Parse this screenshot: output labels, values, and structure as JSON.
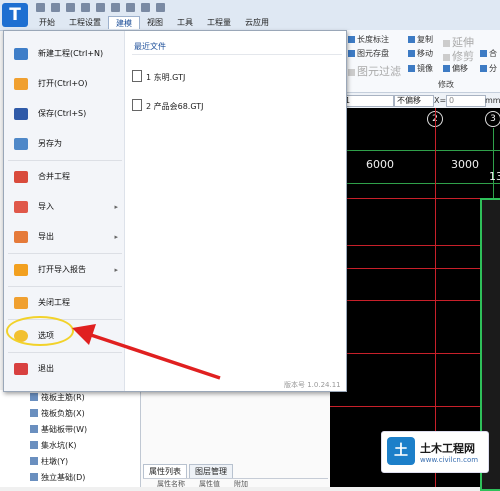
{
  "app": {
    "logo_letter": "T"
  },
  "tabs": [
    "开始",
    "工程设置",
    "建模",
    "视图",
    "工具",
    "工程量",
    "云应用"
  ],
  "ribbon": {
    "items": [
      "长度标注",
      "复制",
      "延伸",
      "图元存盘",
      "移动",
      "修剪",
      "合",
      "图元过滤",
      "镜像",
      "偏移",
      "分"
    ],
    "group_label": "修改"
  },
  "toolbar": {
    "layer_value": "1",
    "offset_select": "不偏移",
    "x_label": "X=",
    "x_value": "0",
    "unit": "mm"
  },
  "canvas": {
    "axis_labels": [
      "2",
      "3"
    ],
    "dims": [
      "6000",
      "3000",
      "13"
    ]
  },
  "file_menu": {
    "items": [
      {
        "label": "新建工程(Ctrl+N)",
        "color": "#3f7ec8"
      },
      {
        "label": "打开(Ctrl+O)",
        "color": "#f0a030"
      },
      {
        "label": "保存(Ctrl+S)",
        "color": "#2f5aa8"
      },
      {
        "label": "另存为",
        "color": "#4f88c8"
      },
      {
        "label": "合并工程",
        "color": "#d94b3c"
      },
      {
        "label": "导入",
        "color": "#e0584a"
      },
      {
        "label": "导出",
        "color": "#e57a3a"
      },
      {
        "label": "打开导入报告",
        "color": "#f2a020"
      },
      {
        "label": "关闭工程",
        "color": "#f0a030"
      },
      {
        "label": "选项",
        "color": "#f2c030"
      },
      {
        "label": "退出",
        "color": "#d84040"
      }
    ],
    "recent_title": "最近文件",
    "recent_files": [
      "1 东明.GTJ",
      "2 产品会68.GTJ"
    ],
    "version": "版本号 1.0.24.11"
  },
  "tree": {
    "items": [
      "筏板主筋(R)",
      "筏板负筋(X)",
      "基础板带(W)",
      "集水坑(K)",
      "柱墩(Y)",
      "独立基础(D)"
    ]
  },
  "property_tabs": [
    "属性列表",
    "图层管理"
  ],
  "property_columns": [
    "属性名称",
    "属性值",
    "附加"
  ],
  "watermark": {
    "logo": "土",
    "title": "土木工程网",
    "url": "www.civilcn.com"
  },
  "colors": {
    "accent": "#1e6fd1",
    "highlight": "#f2d22a",
    "arrow": "#e02020",
    "grid_red": "#c8202a",
    "grid_green": "#2fa04a"
  }
}
